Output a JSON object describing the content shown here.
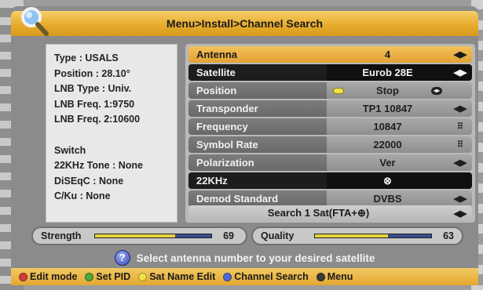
{
  "header": {
    "title": "Menu>Install>Channel Search"
  },
  "info": {
    "type": "Type : USALS",
    "position": "Position : 28.10°",
    "lnb_type": "LNB Type : Univ.",
    "lnb_freq1": "LNB Freq. 1:9750",
    "lnb_freq2": "LNB Freq. 2:10600",
    "switch_title": "Switch",
    "tone": "22KHz Tone : None",
    "diseqc": "DiSEqC : None",
    "c_ku": "C/Ku : None"
  },
  "menu": {
    "antenna": {
      "label": "Antenna",
      "value": "4"
    },
    "satellite": {
      "label": "Satellite",
      "value": "Eurob 28E"
    },
    "position": {
      "label": "Position",
      "value": "Stop"
    },
    "transponder": {
      "label": "Transponder",
      "value": "TP1  10847"
    },
    "frequency": {
      "label": "Frequency",
      "value": "10847"
    },
    "symbol_rate": {
      "label": "Symbol Rate",
      "value": "22000"
    },
    "polarization": {
      "label": "Polarization",
      "value": "Ver"
    },
    "khz22": {
      "label": "22KHz",
      "value": "⊗"
    },
    "demod": {
      "label": "Demod Standard",
      "value": "DVBS"
    },
    "search": {
      "label": "Search 1 Sat(FTA+⊕)"
    },
    "arrows_glyph": "◀▶",
    "keypad_glyph": "⠿"
  },
  "strength": {
    "label": "Strength",
    "value": "69",
    "percent": 69
  },
  "quality": {
    "label": "Quality",
    "value": "63",
    "percent": 63
  },
  "help": {
    "icon_glyph": "?",
    "text": "Select antenna number to your desired satellite"
  },
  "footer": {
    "red": "Edit mode",
    "green": "Set PID",
    "yellow": "Sat Name Edit",
    "blue": "Channel Search",
    "menu": "Menu"
  },
  "colors": {
    "red": "#d23b3b",
    "green": "#4ea83c",
    "yellow": "#f1e04a",
    "blue": "#4f66d4",
    "menu": "#3a3a3a"
  }
}
